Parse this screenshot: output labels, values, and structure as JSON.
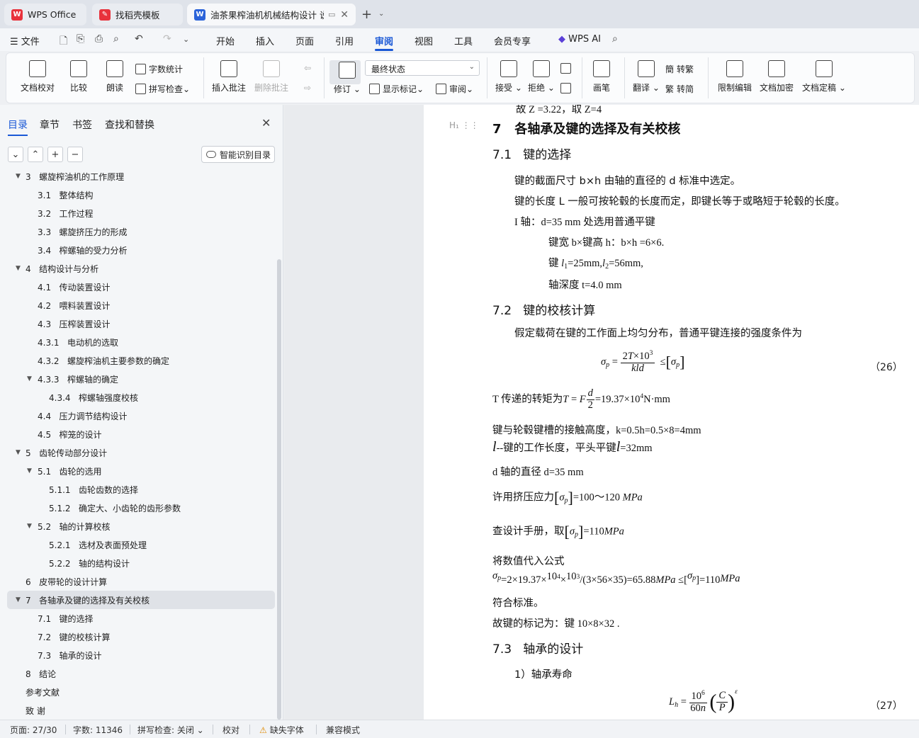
{
  "tabs": [
    {
      "label": "WPS Office",
      "icon": "wps-logo-icon",
      "color": "#e8323c"
    },
    {
      "label": "找稻壳模板",
      "icon": "docer-logo-icon",
      "color": "#e8323c"
    },
    {
      "label": "油茶果榨油机机械结构设计 说",
      "icon": "word-doc-icon",
      "color": "#2b63d9"
    }
  ],
  "menu": {
    "file": "文件",
    "items": [
      "开始",
      "插入",
      "页面",
      "引用",
      "审阅",
      "视图",
      "工具",
      "会员专享"
    ],
    "active": "审阅",
    "ai": "WPS AI"
  },
  "ribbon": {
    "doc_proof": "文档校对",
    "compare": "比较",
    "read_aloud": "朗读",
    "word_count": "字数统计",
    "spell_check": "拼写检查",
    "insert_comment": "插入批注",
    "delete_comment": "删除批注",
    "revise": "修订",
    "status_value": "最终状态",
    "show_marks": "显示标记",
    "review": "审阅",
    "accept": "接受",
    "reject": "拒绝",
    "pen": "画笔",
    "translate": "翻译",
    "to_traditional": "转繁",
    "to_simplified": "转简",
    "restrict_edit": "限制编辑",
    "encrypt": "文档加密",
    "finalize": "文档定稿"
  },
  "nav": {
    "tabs": [
      "目录",
      "章节",
      "书签",
      "查找和替换"
    ],
    "smart_toc": "智能识别目录",
    "toc": [
      {
        "num": "3",
        "text": "螺旋榨油机的工作原理",
        "level": 1,
        "arrow": true
      },
      {
        "num": "3.1",
        "text": "整体结构",
        "level": 2
      },
      {
        "num": "3.2",
        "text": "工作过程",
        "level": 2
      },
      {
        "num": "3.3",
        "text": "螺旋挤压力的形成",
        "level": 2
      },
      {
        "num": "3.4",
        "text": "榨螺轴的受力分析",
        "level": 2
      },
      {
        "num": "4",
        "text": "结构设计与分析",
        "level": 1,
        "arrow": true
      },
      {
        "num": "4.1",
        "text": "传动装置设计",
        "level": 2
      },
      {
        "num": "4.2",
        "text": "喂料装置设计",
        "level": 2
      },
      {
        "num": "4.3",
        "text": "压榨装置设计",
        "level": 2
      },
      {
        "num": "4.3.1",
        "text": "电动机的选取",
        "level": 2
      },
      {
        "num": "4.3.2",
        "text": "螺旋榨油机主要参数的确定",
        "level": 2
      },
      {
        "num": "4.3.3",
        "text": "榨螺轴的确定",
        "level": 2,
        "arrow": true
      },
      {
        "num": "4.3.4",
        "text": "榨螺轴强度校核",
        "level": 3
      },
      {
        "num": "4.4",
        "text": "压力调节结构设计",
        "level": 2
      },
      {
        "num": "4.5",
        "text": "榨笼的设计",
        "level": 2
      },
      {
        "num": "5",
        "text": "齿轮传动部分设计",
        "level": 1,
        "arrow": true
      },
      {
        "num": "5.1",
        "text": "齿轮的选用",
        "level": 2,
        "arrow": true
      },
      {
        "num": "5.1.1",
        "text": "齿轮齿数的选择",
        "level": 3
      },
      {
        "num": "5.1.2",
        "text": "确定大、小齿轮的齿形参数",
        "level": 3
      },
      {
        "num": "5.2",
        "text": "轴的计算校核",
        "level": 2,
        "arrow": true
      },
      {
        "num": "5.2.1",
        "text": "选材及表面预处理",
        "level": 3
      },
      {
        "num": "5.2.2",
        "text": "轴的结构设计",
        "level": 3
      },
      {
        "num": "6",
        "text": "皮带轮的设计计算",
        "level": 1
      },
      {
        "num": "7",
        "text": "各轴承及键的选择及有关校核",
        "level": 1,
        "arrow": true,
        "selected": true
      },
      {
        "num": "7.1",
        "text": "键的选择",
        "level": 2
      },
      {
        "num": "7.2",
        "text": "键的校核计算",
        "level": 2
      },
      {
        "num": "7.3",
        "text": "轴承的设计",
        "level": 2
      },
      {
        "num": "8",
        "text": "结论",
        "level": 1
      },
      {
        "num": "",
        "text": "参考文献",
        "level": 1
      },
      {
        "num": "",
        "text": "致    谢",
        "level": 1
      }
    ]
  },
  "doc": {
    "top_fragment": "故 Z =3.22，取 Z=4",
    "h_marker": "H₁",
    "h7": {
      "num": "7",
      "text": "各轴承及键的选择及有关校核"
    },
    "h71": {
      "num": "7.1",
      "text": "键的选择"
    },
    "p1": "键的截面尺寸 b×h 由轴的直径的 d 标准中选定。",
    "p2": "键的长度 L 一般可按轮毂的长度而定，即键长等于或略短于轮毂的长度。",
    "p3": "I 轴：d=35 mm  处选用普通平键",
    "p4": "键宽 b×键高 h：b×h =6×6.",
    "p5a": "键 ",
    "p5b": "=25mm,",
    "p5c": "=56mm,",
    "p6": "轴深度  t=4.0 mm",
    "h72": {
      "num": "7.2",
      "text": "键的校核计算"
    },
    "p7": "假定载荷在键的工作面上均匀分布，普通平键连接的强度条件为",
    "eq26": "（26）",
    "p8a": "T 传递的转矩为",
    "p8b": "=19.37×10",
    "p8c": "N·mm",
    "p9": "键与轮毂键槽的接触高度，k=0.5h=0.5×8=4mm",
    "p10a": "--键的工作长度，平头平键",
    "p10b": "=32mm",
    "p11": "d 轴的直径 d=35 mm",
    "p12a": "许用挤压应力",
    "p12b": "=100～120",
    "p13a": "查设计手册，取",
    "p13b": "=110",
    "p14": "将数值代入公式",
    "p15a": "=2×19.37×",
    "p15b": "/(3×56×35)=65.88",
    "p15c": " ≤[",
    "p15d": "]=110",
    "p16": "符合标准。",
    "p17": "故键的标记为：键 10×8×32 .",
    "h73": {
      "num": "7.3",
      "text": "轴承的设计"
    },
    "p18": "1）轴承寿命",
    "eq27": "（27）"
  },
  "status": {
    "page": "页面: 27/30",
    "words": "字数: 11346",
    "spell": "拼写检查: 关闭",
    "proof": "校对",
    "missing_font": "缺失字体",
    "compat": "兼容模式"
  }
}
